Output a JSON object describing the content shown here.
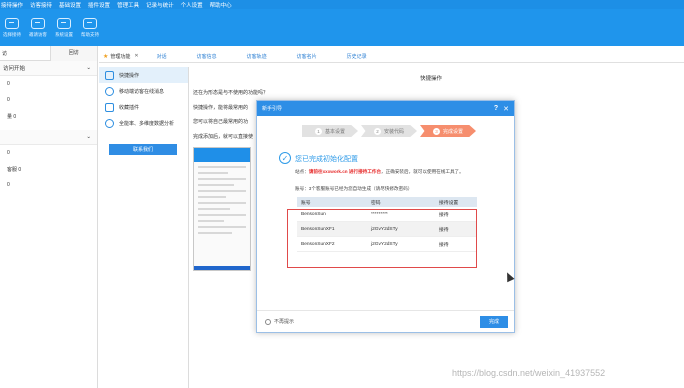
{
  "menubar": [
    "接待操作",
    "访客接待",
    "基础设置",
    "插件设置",
    "管理工具",
    "记录与统计",
    "个人设置",
    "帮助中心"
  ],
  "toolbar": [
    {
      "label": "选择接待",
      "icon": "reception-icon"
    },
    {
      "label": "邀请访客",
      "icon": "invite-icon"
    },
    {
      "label": "系统设置",
      "icon": "settings-icon"
    },
    {
      "label": "帮助支持",
      "icon": "help-icon"
    }
  ],
  "left": {
    "tab1": "访",
    "tab2": "回访",
    "section1": "访问开始",
    "rows1": [
      "0",
      "0",
      "量 0"
    ],
    "section2": "",
    "rows2": [
      "0",
      "客服 0",
      "0"
    ]
  },
  "mid": {
    "items": [
      "快捷操作",
      "移动端访客在线消息",
      "收藏插件",
      "全能率、多维度数据分析"
    ],
    "button": "联系我们"
  },
  "tabs": {
    "first": "管理功能",
    "items": [
      "对话",
      "访客信息",
      "访客轨迹",
      "访客名片",
      "历史记录"
    ]
  },
  "main": {
    "title": "快捷操作",
    "lines": [
      "还在为形态是与不使用的功能吗？",
      "快捷操作，能将最常用的",
      "您可以将自己最常用的功",
      "完成添加后，就可以直接使"
    ]
  },
  "dialog": {
    "title": "新手引导",
    "steps": [
      {
        "num": "1",
        "label": "基本设置"
      },
      {
        "num": "2",
        "label": "安装代码"
      },
      {
        "num": "3",
        "label": "完成设置"
      }
    ],
    "success": "您已完成初始化配置",
    "note_prefix": "站点：",
    "note_highlight": "请前往xxxwork.cn 进行接待工作台",
    "note_suffix": "，正确安装后，就可以使用在线工具了。",
    "note2": "账号：3个客服账号已经为您自动生成（请尽快修改密码）",
    "table": {
      "headers": [
        "账号",
        "密码",
        "接待设置"
      ],
      "rows": [
        [
          "BensonSun",
          "*********",
          "接待"
        ],
        [
          "BensonSunXF1",
          "j2GvY2dSTy",
          "接待"
        ],
        [
          "BensonSunXF2",
          "j2GvY2dSTy",
          "接待"
        ]
      ]
    },
    "dont_show": "不再提示",
    "ok": "完成"
  },
  "watermark": "https://blog.csdn.net/weixin_41937552"
}
